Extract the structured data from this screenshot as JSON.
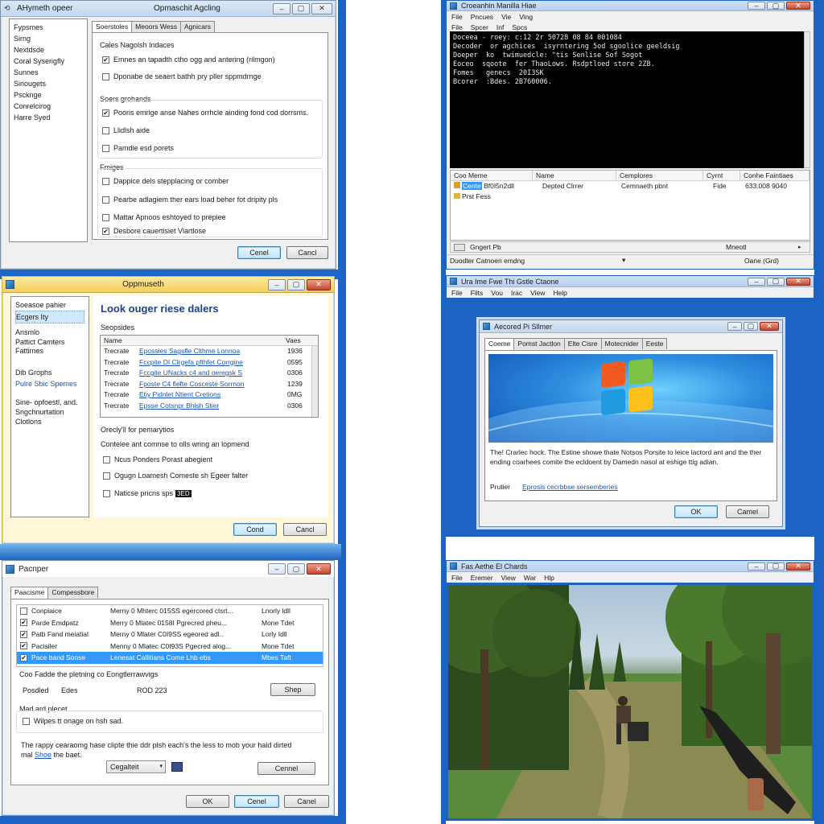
{
  "colors": {
    "desktop_blue": "#1c63c4",
    "win7_aqua": "#6fb3e8",
    "selection_blue": "#3399ff",
    "link_blue": "#1a55b8"
  },
  "tl": {
    "title": "AHymeth opeer",
    "title2": "Opmaschit Agcling",
    "sidebar": [
      "Fypsmes",
      "Sirng",
      "Nextdsde",
      "Coral Syserigfly",
      "Sunnes",
      "Sinougets",
      "Pscknge",
      "Conrelcirog",
      "Harre Syed"
    ],
    "tabs": [
      "Soerstoles",
      "Meoors Wess",
      "Agnicars"
    ],
    "group1_title": "Cales Nagolsh Indaces",
    "group1_items": [
      {
        "label": "Emnes an tapadth ctho ogg and antering (rilmgon)",
        "checked": true
      },
      {
        "label": "Dponabe de seaert bathh pry pller sppmdrnge",
        "checked": false
      }
    ],
    "group2_title": "Soers grohands",
    "group2_items": [
      {
        "label": "Pooris emrige anse Nahes orrhcle ainding fond cod dorrsms.",
        "checked": true
      },
      {
        "label": "Llidlsh aide",
        "checked": false
      },
      {
        "label": "Pamdie esd porets",
        "checked": false
      }
    ],
    "group3_title": "Fmiges",
    "group3_items": [
      {
        "label": "Dappice dels stepplacing or comber",
        "checked": false
      },
      {
        "label": "Pearbe adlagiem ther ears load beher fot dripity pls",
        "checked": false
      },
      {
        "label": "Mattar Apnoos eshtoyed to prepiee",
        "checked": false
      },
      {
        "label": "Desbore cauertisiet Vlartlose",
        "checked": true
      }
    ],
    "ok": "Cenel",
    "cancel": "Cancl"
  },
  "ml": {
    "title": "Oppmuseth",
    "sidebar": [
      "Soeasoe pahier",
      "Ecgers Ity",
      "Ansmlo",
      "Pattict Camters",
      "Fattirnes",
      "Dib Grophs",
      "Pulre Sbic Spemes",
      "Sine- opfoestl, and.",
      "Sngchnurtation",
      "Clotlons"
    ],
    "sidebar_selected_index": 1,
    "sidebar_link_index": 6,
    "heading": "Look ouger riese dalers",
    "sub": "Seopsides",
    "col_name": "Name",
    "col_value": "Vaes",
    "rows": [
      {
        "name": "Trecrate",
        "link": "Epossies Sagsfle Clthme Lonnoa",
        "val": "1936"
      },
      {
        "name": "Trecrate",
        "link": "Fccpite DI Clrgefa pfthfet Corrgine",
        "val": "0595"
      },
      {
        "name": "Trecrate",
        "link": "Fccgite UNacks c4 and oeregsk S",
        "val": "0306"
      },
      {
        "name": "Trecrate",
        "link": "Fposte C4 flefte Cosceste Sorrnon",
        "val": "1239"
      },
      {
        "name": "Trecrate",
        "link": "Etiy Pidnlet Ntient Cretions",
        "val": "0MG"
      },
      {
        "name": "Trecrate",
        "link": "Epsse Cotsnpr Bhlsh Stier",
        "val": "0306"
      }
    ],
    "note1": "Orecly'll for pemarytios",
    "note2": "Contelee ant comnse to olls wring an lopmend",
    "opts": [
      {
        "label": "Ncus Ponders Porast abegient",
        "checked": false
      },
      {
        "label": "Ogugn Loamesh Comeste sh Egeer falter",
        "checked": false
      },
      {
        "label": "Naticse pricns sps",
        "checked": false
      }
    ],
    "opt_badge": "3ED",
    "ok": "Cond",
    "cancel": "Cancl"
  },
  "bl": {
    "title": "Pacnper",
    "tabs": [
      "Paacisme",
      "Compessbore"
    ],
    "rows": [
      {
        "c1": "Conpiaice",
        "c2": "Merny 0 Mhterc 015SS egercored clsrt...",
        "c3": "Lnorly ldll",
        "checked": false,
        "selected": false
      },
      {
        "c1": "Parde Emdpatz",
        "c2": "Merry 0 Mlatec 0158I Pgrecred pheu...",
        "c3": "Mone Tdet",
        "checked": true,
        "selected": false
      },
      {
        "c1": "Patb Fand meiatial",
        "c2": "Merny 0 Mlater C0I9SS egeored adl..",
        "c3": "Lorly Idll",
        "checked": true,
        "selected": false
      },
      {
        "c1": "Pacisiler",
        "c2": "Menny 0 Mlatec C0I93S Pgecred alog...",
        "c3": "Mone Tdet",
        "checked": true,
        "selected": false
      },
      {
        "c1": "Pace band Sonse",
        "c2": "Lenesat Callitians Come Lhb ebs",
        "c3": "Mbes Taft",
        "checked": true,
        "selected": true
      }
    ],
    "row_label": "Coo Fadde the pletning co Eongtlerrawvigs",
    "field_a": "Posdled",
    "field_b": "Edes",
    "field_c": "ROD 223",
    "shop_btn": "Shep",
    "grp_title": "Mad ard plecet",
    "grp_chk": "Wilpes tt onage on hsh sad.",
    "desc": "The rappy cearaomg hase clipte thie ddr plsh each's the less to mob your haid dirted",
    "desc2a": "mal ",
    "desc2_link": "Shoe",
    "desc2b": " the baet.",
    "combo": "Cegalteit",
    "btn_connel": "Cennel",
    "ok": "OK",
    "cancel": "Cenel",
    "cancel2": "Canel"
  },
  "tr": {
    "title": "Croeanhin Manilla Hiae",
    "menu": [
      "File",
      "Pncues",
      "Vie",
      "Ving"
    ],
    "menu2": [
      "File",
      "Spcer",
      "Inf",
      "Spcs"
    ],
    "console": "Doceea - roey: c:12 2r 50728 08 84 001084\nDecoder  or agchices  isyrntering 5od sgoolice geeldsig\nDoeper  ko  twimuedcle: \"tis Senlise Sof Sogot\nEoceo  sqoote  fer ThaoLows. Rsdptloed store 2ZB.\nFomes   genecs  20I3SK\nBcorer  :Bdes. 2B760006.",
    "cols": [
      "Coo Meme",
      "Name",
      "Cemplores",
      "Cyrnt",
      "Conhe Faintiaes"
    ],
    "row": {
      "a": "Cente",
      "a2": "Bf0I5n2dll",
      "b": "Depted Clrrer",
      "c": "Cemnaeth pbnt",
      "d": "Fide",
      "e": "633.008 9040"
    },
    "row2": "Prst Fess",
    "status_left": "Gngert Pb",
    "status_mid": "Mneotl",
    "status2_left": "Duodter Catnoen emdng",
    "status2_mid": "▾",
    "status2_right": "Oane (Grd)"
  },
  "mr": {
    "title": "Ura Ime Fwe Thi Gstle Ctaone",
    "menu": [
      "File",
      "Filts",
      "Vou",
      "Irac",
      "View",
      "Help"
    ],
    "dlg_title": "Aecored Pi Sllmer",
    "tabs": [
      "Coeme",
      "Pomst Jactlon",
      "Elte Cisre",
      "Motecnider",
      "Eeste"
    ],
    "body": "The! Crarlec hock. The Estine showe thate Notsos Porsite to leice lactord ant and the ther ending coarhees comite the ecldoent by Damedn nasol at eshige ttig adian.",
    "field_label": "Prutier",
    "field_link": "Eprosls cecrbbse sersemberies",
    "ok": "OK",
    "cancel": "Camel"
  },
  "br": {
    "title": "Fas Aethe El Chards",
    "menu": [
      "File",
      "Eremer",
      "View",
      "War",
      "Hlp"
    ]
  }
}
